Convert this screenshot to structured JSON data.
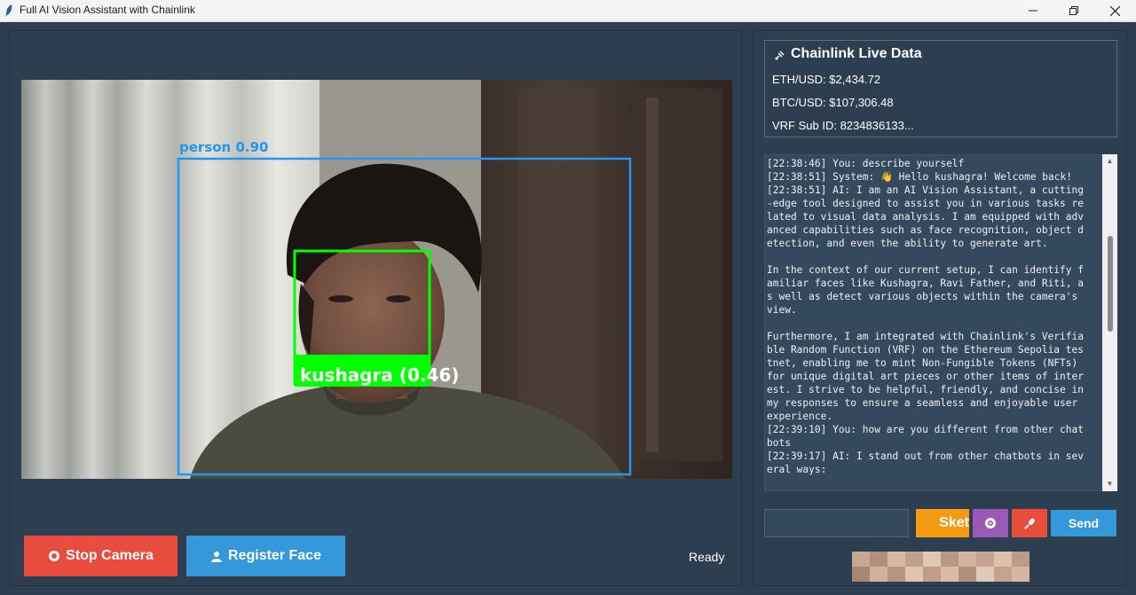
{
  "window": {
    "title": "Full AI Vision Assistant with Chainlink"
  },
  "camera": {
    "detections": [
      {
        "label": "person  0.90",
        "color": "#2196f3"
      },
      {
        "label": "kushagra (0.46)",
        "color": "#00ff00"
      }
    ]
  },
  "controls": {
    "stop_camera_label": "Stop Camera",
    "register_face_label": "Register Face",
    "status_text": "Ready",
    "stop_color": "#e74c3c",
    "register_color": "#3498db"
  },
  "chainlink": {
    "title": "Chainlink Live Data",
    "eth": "ETH/USD: $2,434.72",
    "btc": "BTC/USD: $107,306.48",
    "vrf": "VRF Sub ID: 8234836133..."
  },
  "chat": {
    "log": [
      "[22:38:46] You: describe yourself",
      "[22:38:51] System: 👋 Hello kushagra! Welcome back!",
      "[22:38:51] AI: I am an AI Vision Assistant, a cutting",
      "-edge tool designed to assist you in various tasks re",
      "lated to visual data analysis. I am equipped with adv",
      "anced capabilities such as face recognition, object d",
      "etection, and even the ability to generate art.",
      "",
      "In the context of our current setup, I can identify f",
      "amiliar faces like Kushagra, Ravi Father, and Riti, a",
      "s well as detect various objects within the camera's",
      "view.",
      "",
      "Furthermore, I am integrated with Chainlink's Verifia",
      "ble Random Function (VRF) on the Ethereum Sepolia tes",
      "tnet, enabling me to mint Non-Fungible Tokens (NFTs)",
      "for unique digital art pieces or other items of inter",
      "est. I strive to be helpful, friendly, and concise in",
      "my responses to ensure a seamless and enjoyable user",
      "experience.",
      "[22:39:10] You: how are you different from other chat",
      "bots",
      "[22:39:17] AI: I stand out from other chatbots in sev",
      "eral ways:"
    ],
    "input_value": "",
    "sketch_label": "Sket",
    "send_label": "Send",
    "sketch_color": "#f39c12",
    "vision_color": "#9b59b6",
    "mic_color": "#e74c3c",
    "send_color": "#3498db"
  }
}
